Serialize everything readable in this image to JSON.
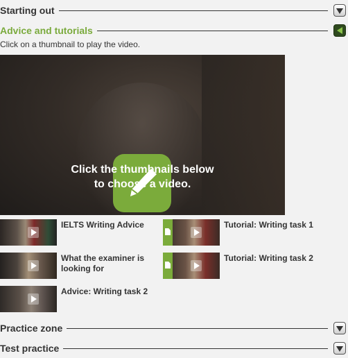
{
  "sections": {
    "starting_out": "Starting out",
    "advice": "Advice and tutorials",
    "practice": "Practice zone",
    "test": "Test practice"
  },
  "instruction": "Click on a thumbnail to play the video.",
  "player": {
    "caption_line1": "Click the thumbnails below",
    "caption_line2": "to choose a video."
  },
  "videos": [
    {
      "title": "IELTS Writing Advice"
    },
    {
      "title": "Tutorial: Writing task 1"
    },
    {
      "title": "What the examiner is looking for"
    },
    {
      "title": "Tutorial: Writing task 2"
    },
    {
      "title": "Advice: Writing task 2"
    }
  ],
  "colors": {
    "accent": "#7bab3b",
    "active_header": "#7aaa3c",
    "active_button": "#2f4a1f"
  },
  "icons": {
    "collapsed": "chevron-down-icon",
    "expanded": "triangle-left-icon",
    "player_center": "pencil-icon",
    "thumbnail": "play-icon",
    "document": "document-icon"
  }
}
